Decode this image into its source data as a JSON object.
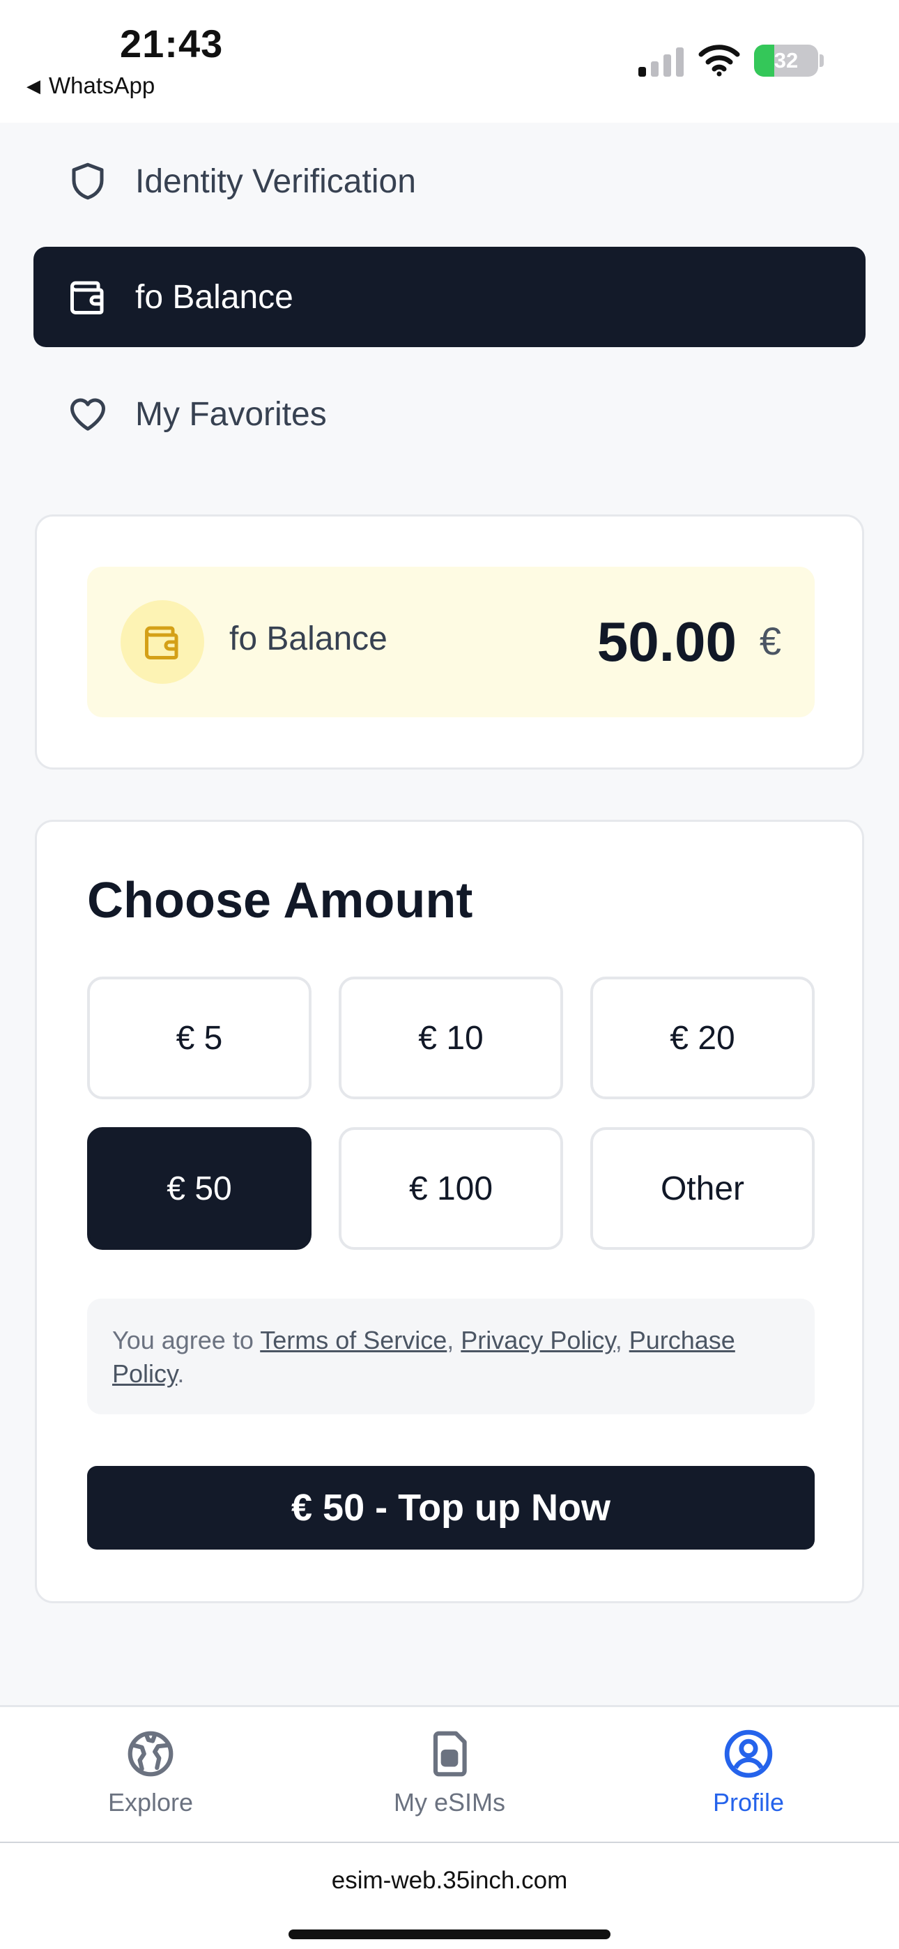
{
  "status_bar": {
    "time": "21:43",
    "back_app": "WhatsApp",
    "battery_level": 32,
    "battery_text": "32"
  },
  "menu": {
    "items": [
      {
        "label": "Identity Verification",
        "icon": "shield-icon",
        "active": false
      },
      {
        "label": "fo Balance",
        "icon": "wallet-icon",
        "active": true
      },
      {
        "label": "My Favorites",
        "icon": "heart-icon",
        "active": false
      }
    ]
  },
  "balance": {
    "label": "fo Balance",
    "amount": "50.00",
    "currency": "€"
  },
  "choose_amount": {
    "title": "Choose Amount",
    "options": [
      {
        "label": "€ 5",
        "selected": false
      },
      {
        "label": "€ 10",
        "selected": false
      },
      {
        "label": "€ 20",
        "selected": false
      },
      {
        "label": "€ 50",
        "selected": true
      },
      {
        "label": "€ 100",
        "selected": false
      },
      {
        "label": "Other",
        "selected": false
      }
    ]
  },
  "terms": {
    "prefix": "You agree to ",
    "terms_link": "Terms of Service",
    "sep1": ", ",
    "privacy_link": "Privacy Policy",
    "sep2": ", ",
    "purchase_link": "Purchase Policy",
    "suffix": "."
  },
  "topup_button": "€ 50 - Top up Now",
  "bottom_nav": {
    "items": [
      {
        "label": "Explore",
        "icon": "globe-icon",
        "active": false
      },
      {
        "label": "My eSIMs",
        "icon": "sim-card-icon",
        "active": false
      },
      {
        "label": "Profile",
        "icon": "profile-icon",
        "active": true
      }
    ]
  },
  "browser": {
    "url": "esim-web.35inch.com"
  },
  "colors": {
    "dark": "#131a29",
    "accent": "#2563eb",
    "balance_bg": "#fefbe3",
    "wallet_yellow": "#d4a017"
  }
}
